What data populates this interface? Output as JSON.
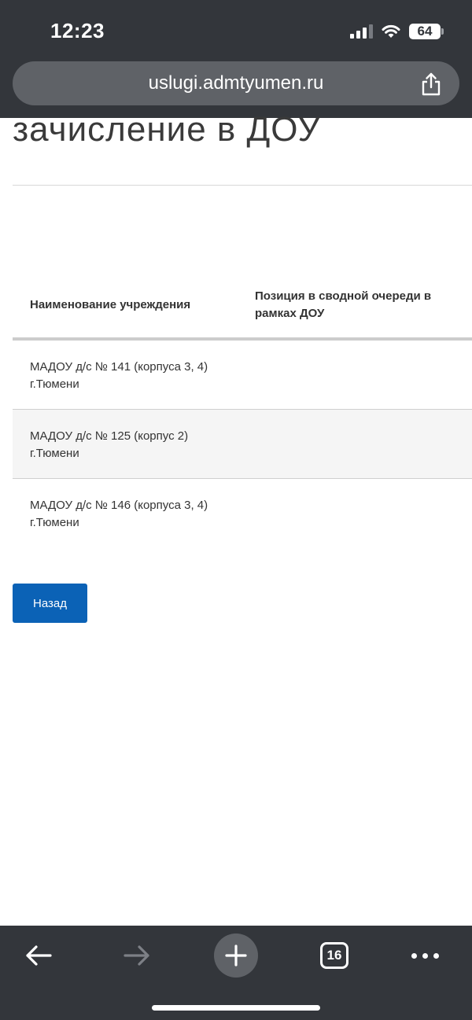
{
  "status_bar": {
    "time": "12:23",
    "battery": "64",
    "icons": [
      "signal-icon",
      "wifi-icon",
      "battery-icon"
    ]
  },
  "browser": {
    "url": "uslugi.admtyumen.ru",
    "share_icon": "share-icon",
    "toolbar": {
      "back_icon": "arrow-left-icon",
      "forward_icon": "arrow-right-icon",
      "new_tab_icon": "plus-icon",
      "tab_count": "16",
      "more_icon": "more-dots-icon"
    }
  },
  "page": {
    "heading": "зачисление в ДОУ",
    "table": {
      "headers": [
        "Наименование учреждения",
        "Позиция в сводной очереди в рамках ДОУ"
      ],
      "rows": [
        {
          "name": "МАДОУ д/с № 141 (корпуса 3, 4) г.Тюмени",
          "position": ""
        },
        {
          "name": "МАДОУ д/с № 125 (корпус 2) г.Тюмени",
          "position": ""
        },
        {
          "name": "МАДОУ д/с № 146 (корпуса 3, 4) г.Тюмени",
          "position": ""
        }
      ]
    },
    "back_button": "Назад"
  },
  "colors": {
    "chrome_bg": "#33363b",
    "url_pill": "#5f6267",
    "button_blue": "#0b62b6",
    "alt_row": "#f5f5f5"
  }
}
